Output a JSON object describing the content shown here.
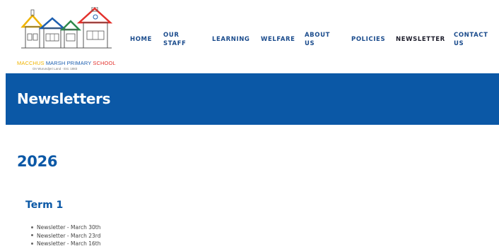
{
  "school": {
    "name_part1": "MACCHUS",
    "name_part2": "MARSH PRIMARY",
    "name_part3": "SCHOOL",
    "tagline": "On Wurundjeri Land · Est. 1883"
  },
  "nav": {
    "home": "HOME",
    "our_staff_1": "OUR",
    "our_staff_2": "STAFF",
    "learning": "LEARNING",
    "welfare": "WELFARE",
    "about_1": "ABOUT",
    "about_2": "US",
    "policies": "POLICIES",
    "newsletter": "NEWSLETTER",
    "contact_1": "CONTACT",
    "contact_2": "US"
  },
  "banner": {
    "title": "Newsletters"
  },
  "content": {
    "year": "2026",
    "term": "Term 1",
    "newsletters": [
      "Newsletter - March 30th",
      "Newsletter - March 23rd",
      "Newsletter - March 16th"
    ]
  },
  "colors": {
    "brand_blue": "#0b58a6",
    "nav_blue": "#1a4b8c",
    "logo_yellow": "#f0b400",
    "logo_red": "#e3322d"
  }
}
